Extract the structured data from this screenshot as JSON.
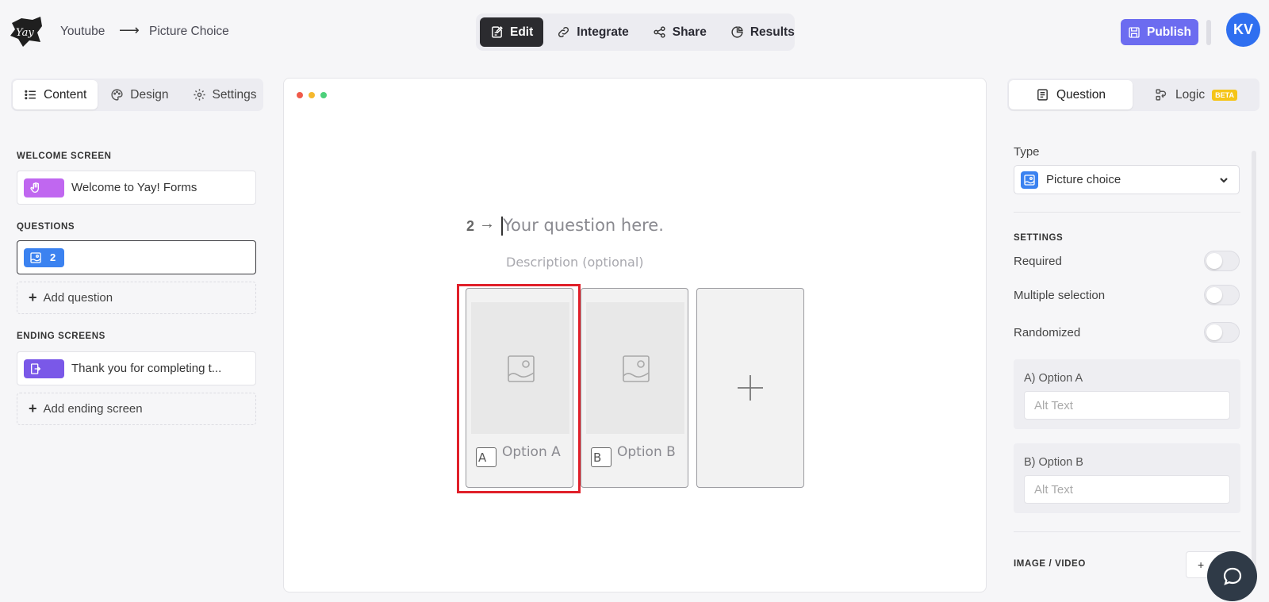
{
  "header": {
    "breadcrumb": [
      "Youtube",
      "Picture Choice"
    ],
    "breadcrumb_separator": "⟶",
    "nav": [
      {
        "label": "Edit",
        "icon": "edit-icon",
        "active": true
      },
      {
        "label": "Integrate",
        "icon": "link-icon",
        "active": false
      },
      {
        "label": "Share",
        "icon": "share-icon",
        "active": false
      },
      {
        "label": "Results",
        "icon": "pie-chart-icon",
        "active": false
      }
    ],
    "publish_label": "Publish",
    "avatar_initials": "KV"
  },
  "left_panel": {
    "tabs": [
      {
        "label": "Content",
        "icon": "list-icon",
        "active": true
      },
      {
        "label": "Design",
        "icon": "palette-icon",
        "active": false
      },
      {
        "label": "Settings",
        "icon": "gear-icon",
        "active": false
      }
    ],
    "welcome_label": "WELCOME SCREEN",
    "welcome_item": "Welcome to Yay! Forms",
    "questions_label": "QUESTIONS",
    "question_item_number": "2",
    "add_question": "Add question",
    "endings_label": "ENDING SCREENS",
    "ending_item": "Thank you for completing t...",
    "add_ending": "Add ending screen"
  },
  "canvas": {
    "question_number": "2",
    "question_arrow": "→",
    "question_placeholder": "Your question here.",
    "description_placeholder": "Description (optional)",
    "options": [
      {
        "key": "A",
        "label": "Option A",
        "selected": true
      },
      {
        "key": "B",
        "label": "Option B",
        "selected": false
      }
    ],
    "add_option_icon": "plus-icon"
  },
  "right_panel": {
    "tabs": [
      {
        "label": "Question",
        "icon": "question-icon",
        "active": true
      },
      {
        "label": "Logic",
        "icon": "logic-icon",
        "badge": "BETA",
        "active": false
      }
    ],
    "type_label": "Type",
    "type_value": "Picture choice",
    "settings_label": "SETTINGS",
    "toggles": [
      {
        "label": "Required",
        "on": false
      },
      {
        "label": "Multiple selection",
        "on": false
      },
      {
        "label": "Randomized",
        "on": false
      }
    ],
    "option_panels": [
      {
        "title": "A) Option A",
        "alt_placeholder": "Alt Text"
      },
      {
        "title": "B) Option B",
        "alt_placeholder": "Alt Text"
      }
    ],
    "image_video_label": "IMAGE / VIDEO",
    "image_video_add": "+"
  },
  "colors": {
    "accent": "#6c6cf0",
    "avatar": "#2f6ff0",
    "highlight": "#e0202a",
    "chip_blue": "#3b82f0",
    "chip_purple": "#c067f0",
    "chip_violet": "#7a58e8"
  }
}
